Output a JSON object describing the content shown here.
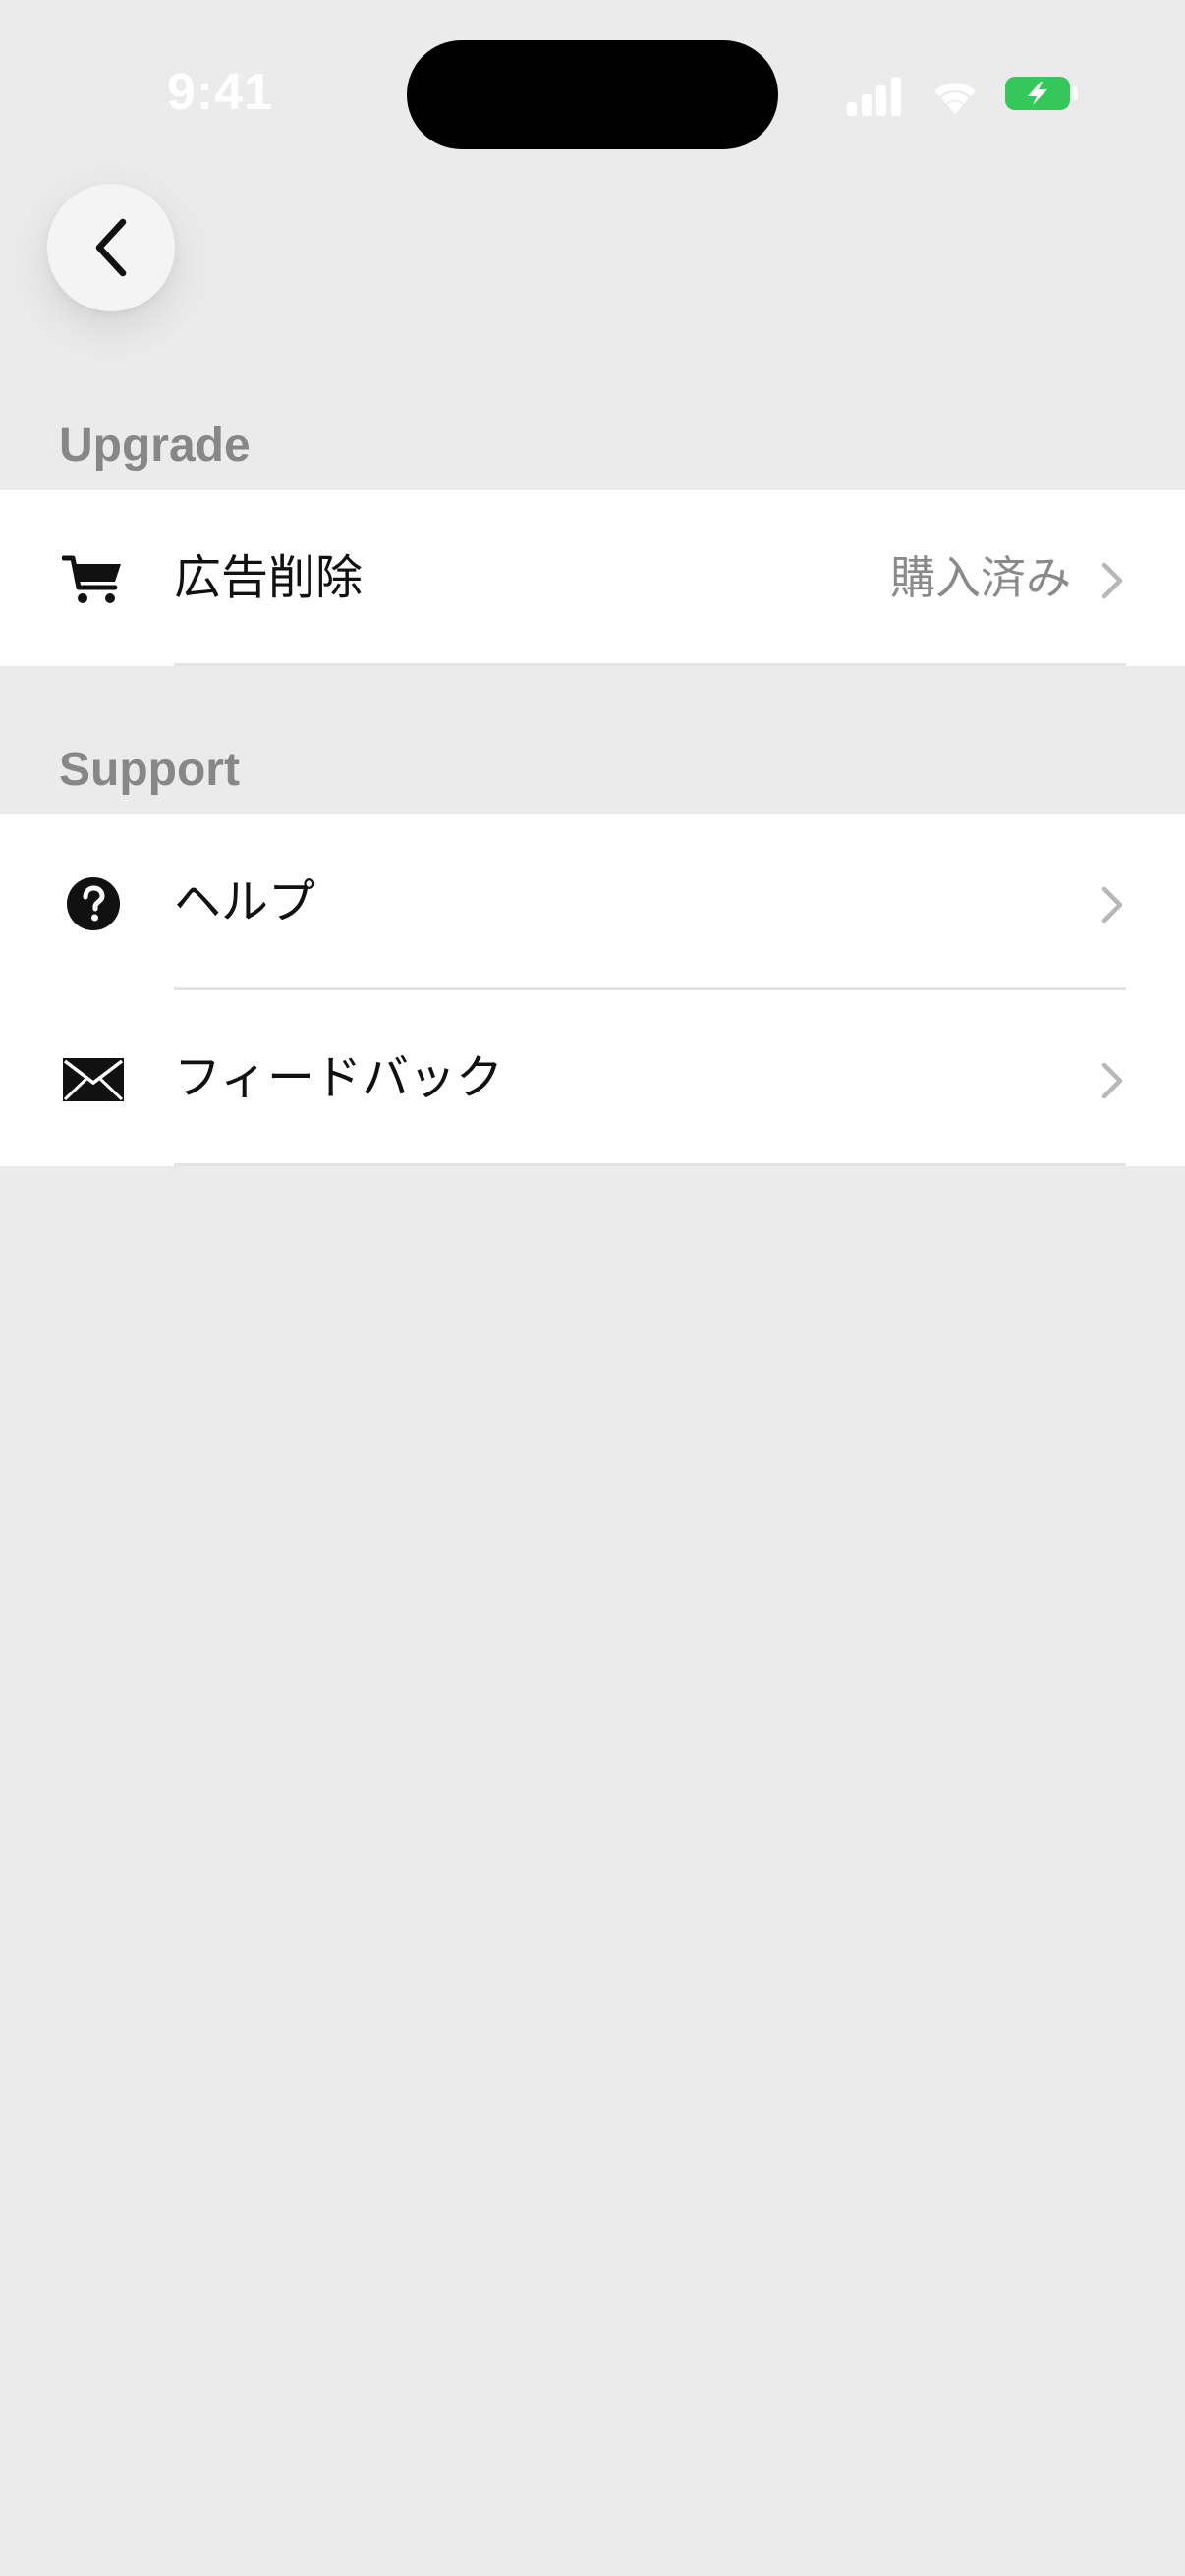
{
  "status_bar": {
    "time": "9:41"
  },
  "navigation": {
    "back_icon": "chevron-left-icon"
  },
  "sections": [
    {
      "header": "Upgrade",
      "rows": [
        {
          "icon": "cart-icon",
          "label": "広告削除",
          "value": "購入済み"
        }
      ]
    },
    {
      "header": "Support",
      "rows": [
        {
          "icon": "question-circle-icon",
          "label": "ヘルプ",
          "value": ""
        },
        {
          "icon": "envelope-icon",
          "label": "フィードバック",
          "value": ""
        }
      ]
    }
  ],
  "colors": {
    "background": "#ebebeb",
    "row_background": "#ffffff",
    "section_header": "#878787",
    "secondary_text": "#8a8a8a",
    "battery_green": "#34c759"
  }
}
